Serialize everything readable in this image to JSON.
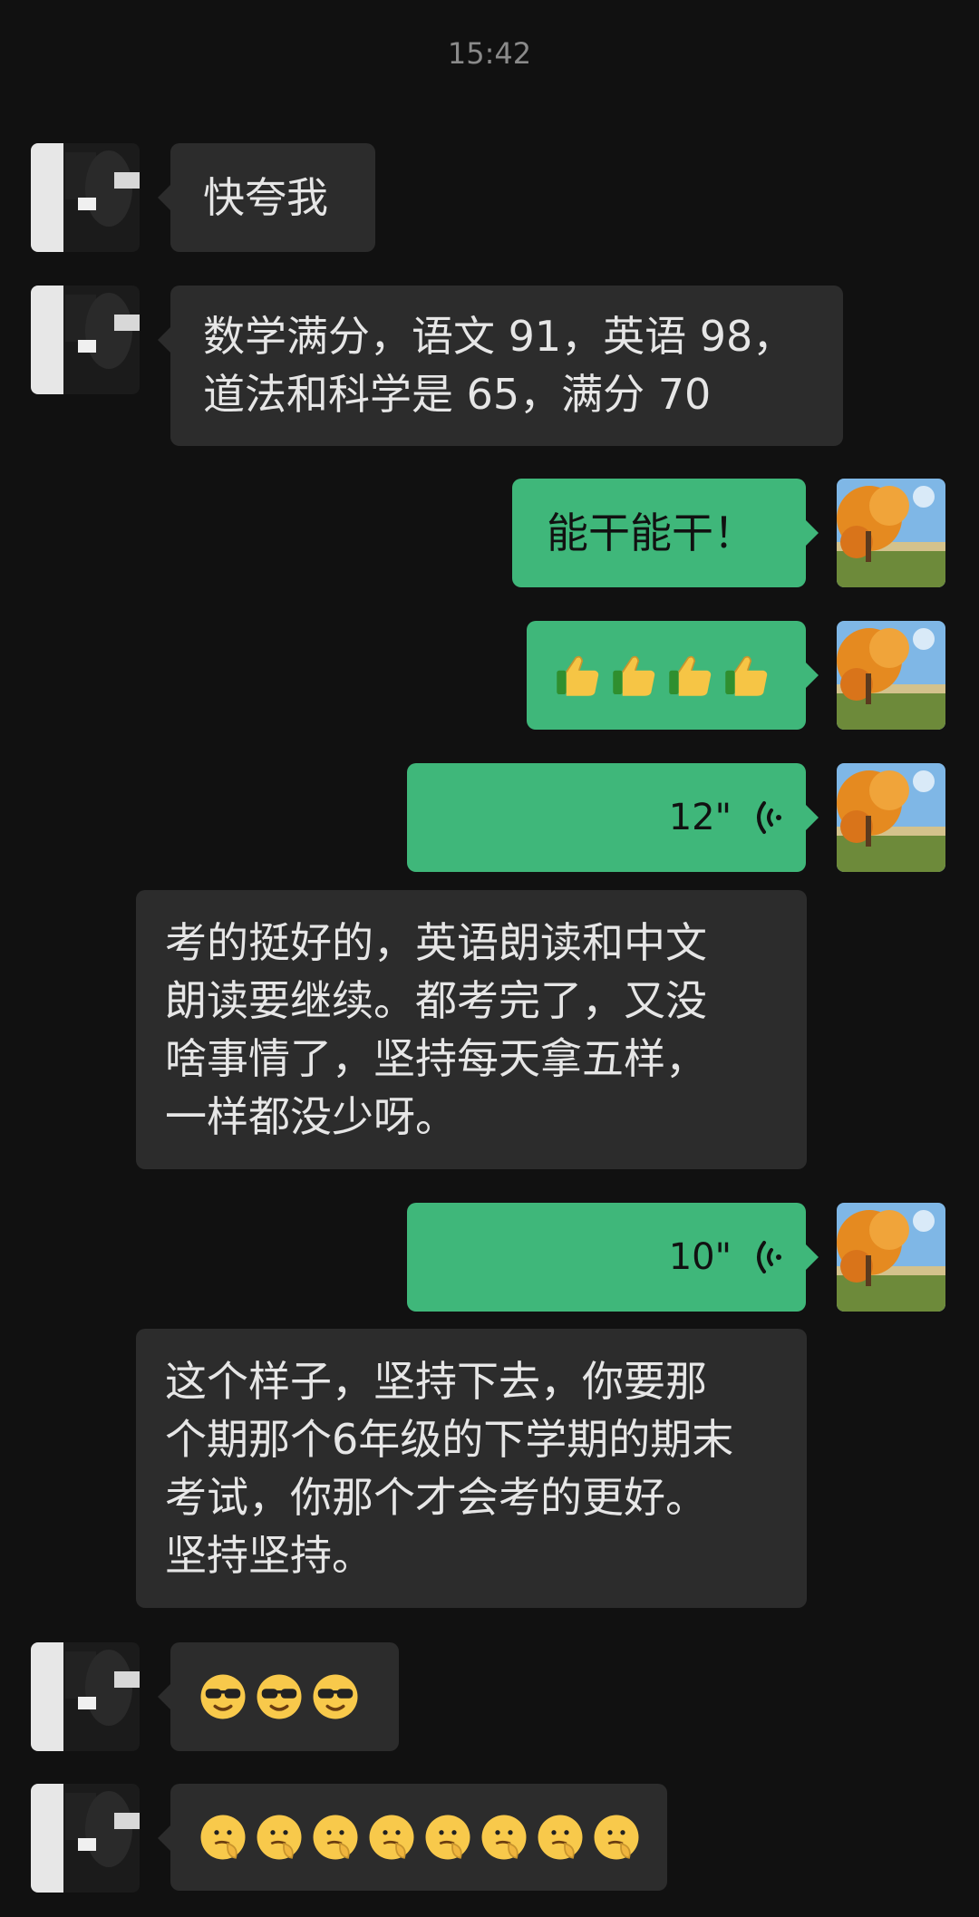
{
  "chat": {
    "timestamp": "15:42",
    "messages": [
      {
        "side": "left",
        "text": "快夸我"
      },
      {
        "side": "left",
        "text": "数学满分，语文 91，英语 98，\n道法和科学是 65，满分 70"
      },
      {
        "side": "right",
        "text": "能干能干！"
      },
      {
        "side": "right",
        "emoji": "thumbs-up-icon",
        "count": 4
      },
      {
        "side": "right",
        "voice_duration": "12\""
      },
      {
        "side": "left",
        "text": "考的挺好的，英语朗读和中文\n朗读要继续。都考完了，又没\n啥事情了，坚持每天拿五样，\n一样都没少呀。"
      },
      {
        "side": "right",
        "voice_duration": "10\""
      },
      {
        "side": "left",
        "text": "这个样子，坚持下去，你要那\n个期那个6年级的下学期的期末\n考试，你那个才会考的更好。\n坚持坚持。"
      },
      {
        "side": "left",
        "emoji": "sunglasses-face-icon",
        "count": 3
      },
      {
        "side": "left",
        "emoji": "thinking-face-icon",
        "count": 8
      }
    ]
  },
  "colors": {
    "background": "#111111",
    "left_bubble": "#2c2c2c",
    "right_bubble": "#3fb77a",
    "timestamp": "#8a8a8a"
  },
  "avatars": {
    "left": "dark-grayscale-photo-avatar",
    "right": "autumn-tree-avatar"
  }
}
